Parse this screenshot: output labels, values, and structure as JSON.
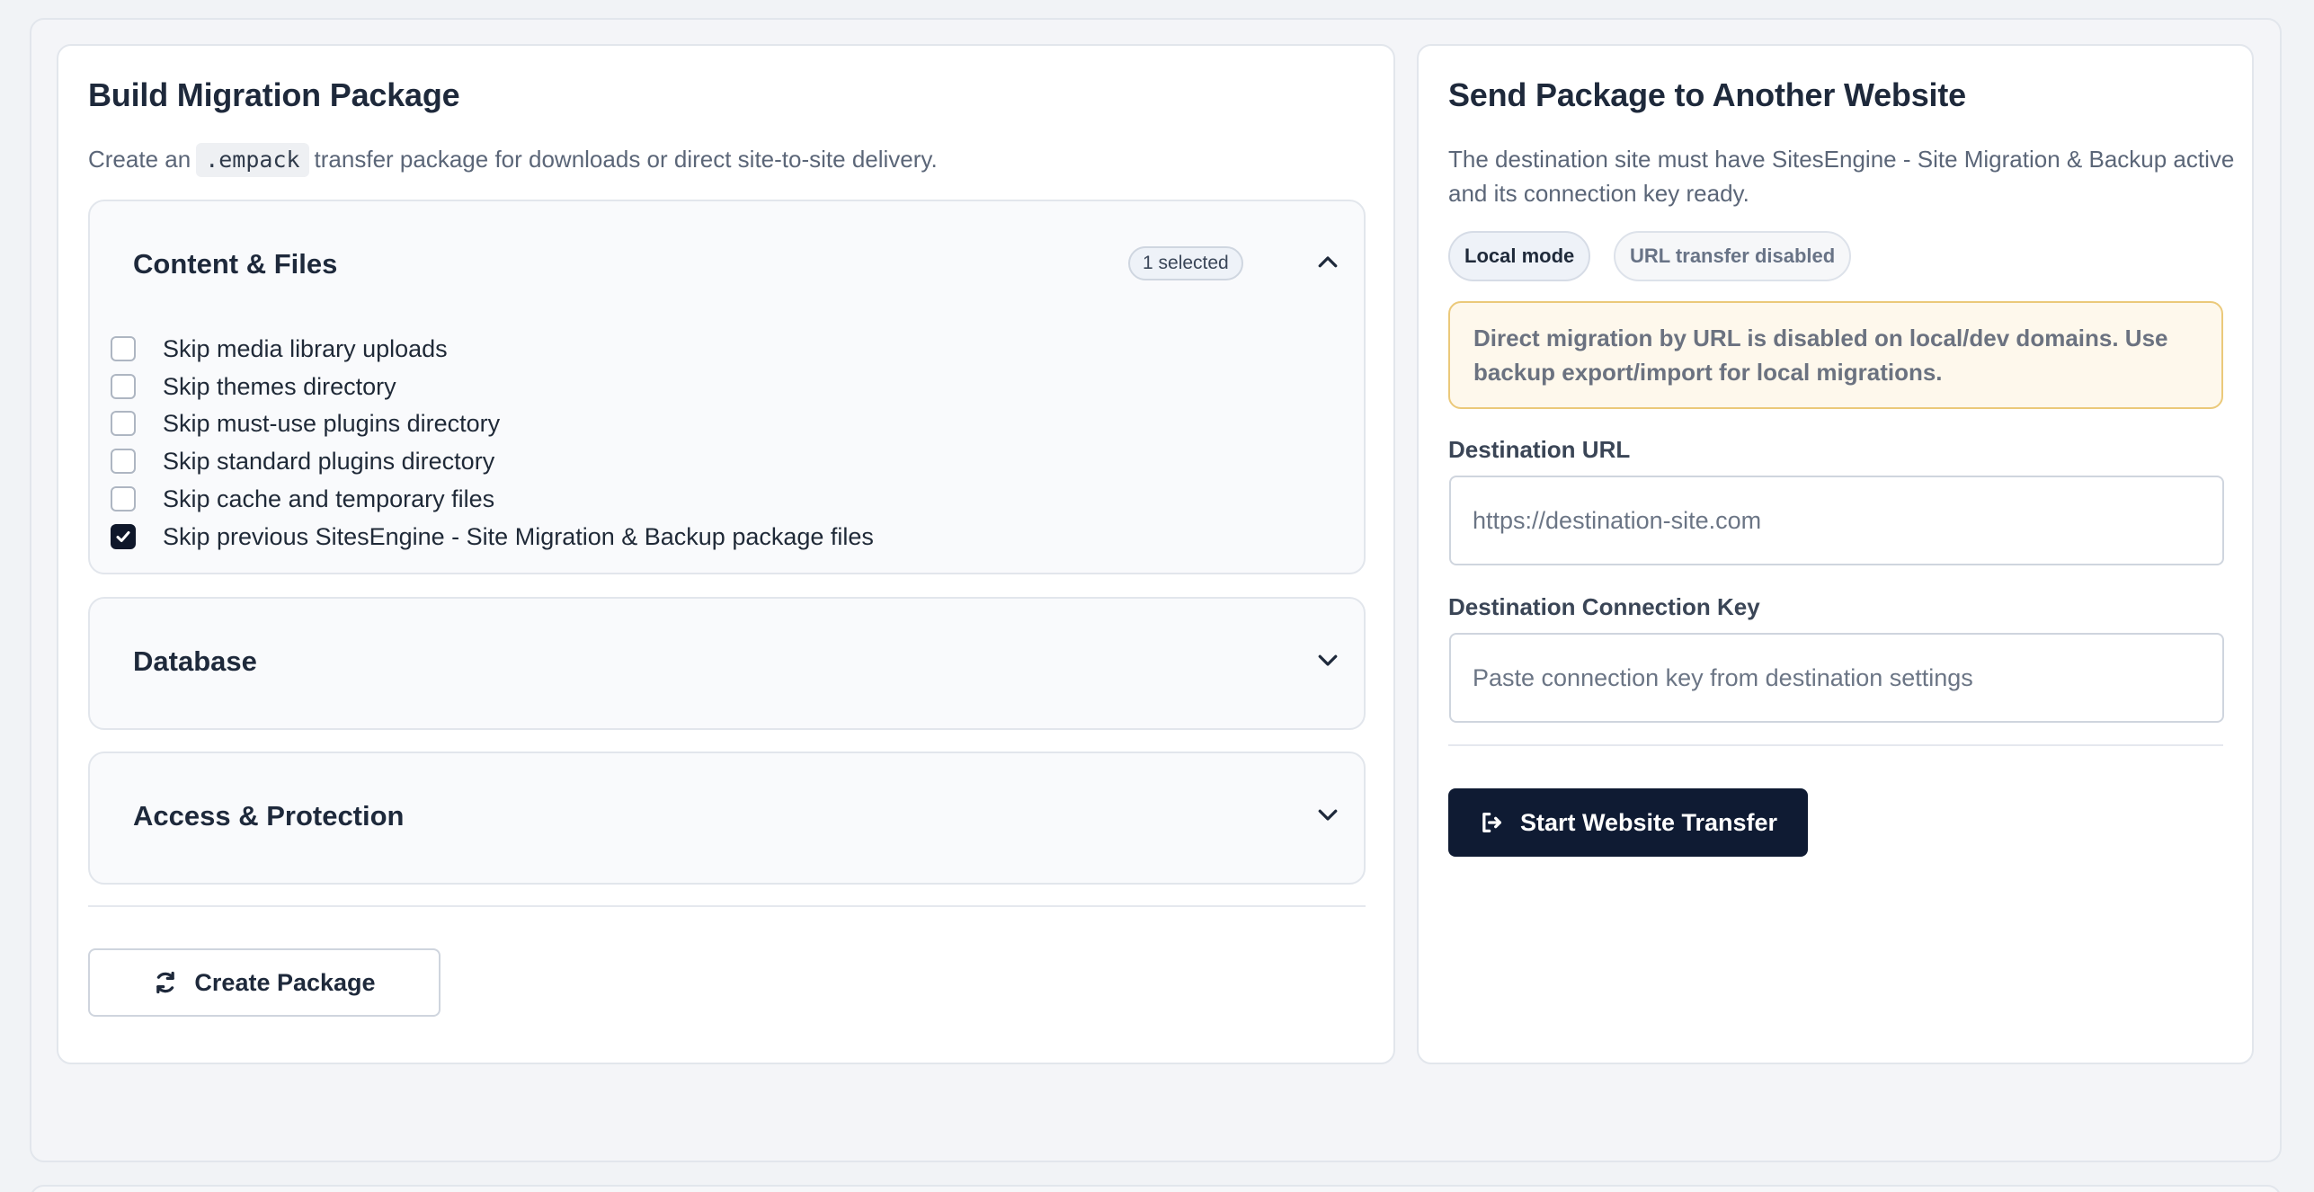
{
  "build": {
    "title": "Build Migration Package",
    "subtitle_before": "Create an",
    "subtitle_code": ".empack",
    "subtitle_after": "transfer package for downloads or direct site-to-site delivery.",
    "sections": {
      "content": {
        "title": "Content & Files",
        "badge": "1 selected",
        "expanded": true,
        "options": [
          {
            "label": "Skip media library uploads",
            "checked": false
          },
          {
            "label": "Skip themes directory",
            "checked": false
          },
          {
            "label": "Skip must-use plugins directory",
            "checked": false
          },
          {
            "label": "Skip standard plugins directory",
            "checked": false
          },
          {
            "label": "Skip cache and temporary files",
            "checked": false
          },
          {
            "label": "Skip previous SitesEngine - Site Migration & Backup package files",
            "checked": true
          }
        ]
      },
      "database": {
        "title": "Database",
        "expanded": false
      },
      "access": {
        "title": "Access & Protection",
        "expanded": false
      }
    },
    "create_button": "Create Package"
  },
  "send": {
    "title": "Send Package to Another Website",
    "description": "The destination site must have SitesEngine - Site Migration & Backup active and its connection key ready.",
    "pills": {
      "local": "Local mode",
      "url": "URL transfer disabled"
    },
    "alert": "Direct migration by URL is disabled on local/dev domains. Use backup export/import for local migrations.",
    "url_label": "Destination URL",
    "url_placeholder": "https://destination-site.com",
    "url_value": "",
    "key_label": "Destination Connection Key",
    "key_placeholder": "Paste connection key from destination settings",
    "key_value": "",
    "transfer_button": "Start Website Transfer"
  },
  "colors": {
    "primary_dark": "#0f1b33",
    "alert_border": "#ebc97a",
    "alert_bg": "#fef8ec"
  }
}
